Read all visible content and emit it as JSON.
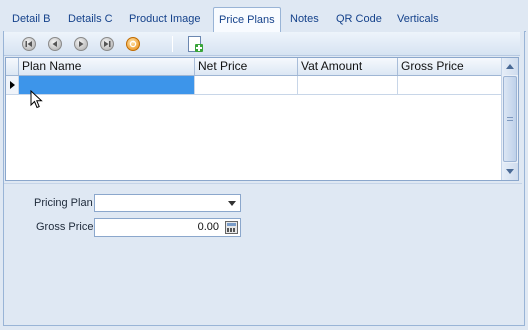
{
  "tabs": [
    {
      "label": "Detail B",
      "active": false
    },
    {
      "label": "Details C",
      "active": false
    },
    {
      "label": "Product Image",
      "active": false
    },
    {
      "label": "Price Plans",
      "active": true
    },
    {
      "label": "Notes",
      "active": false
    },
    {
      "label": "QR Code",
      "active": false
    },
    {
      "label": "Verticals",
      "active": false
    }
  ],
  "toolbar": {
    "buttons": [
      "first-record-icon",
      "previous-record-icon",
      "next-record-icon",
      "last-record-icon",
      "refresh-icon",
      "new-record-icon"
    ]
  },
  "grid": {
    "columns": [
      "Plan Name",
      "Net Price",
      "Vat Amount",
      "Gross Price"
    ],
    "rows": [
      {
        "plan_name": "",
        "net_price": "",
        "vat_amount": "",
        "gross_price": ""
      }
    ]
  },
  "form": {
    "pricing_plan_label": "Pricing Plan",
    "pricing_plan_value": "",
    "gross_price_label": "Gross Price",
    "gross_price_value": "0.00"
  },
  "colors": {
    "accent": "#15428b",
    "selection": "#3d95ea",
    "border": "#99b4d6",
    "background": "#dfe8f3"
  }
}
